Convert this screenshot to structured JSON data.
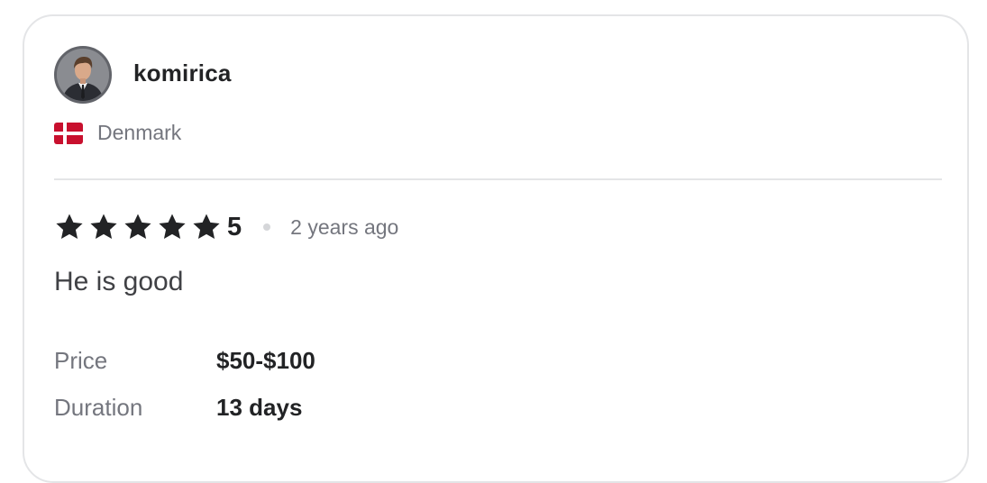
{
  "review": {
    "username": "komirica",
    "country": "Denmark",
    "country_flag": "denmark-flag",
    "rating": "5",
    "stars_filled": 5,
    "stars_total": 5,
    "time_ago": "2 years ago",
    "text": "He is good",
    "details": [
      {
        "label": "Price",
        "value": "$50-$100"
      },
      {
        "label": "Duration",
        "value": "13 days"
      }
    ]
  },
  "colors": {
    "star": "#222325",
    "flag_red": "#c8102e",
    "flag_white": "#ffffff",
    "muted_text": "#74767e",
    "border": "#e4e5e7"
  }
}
